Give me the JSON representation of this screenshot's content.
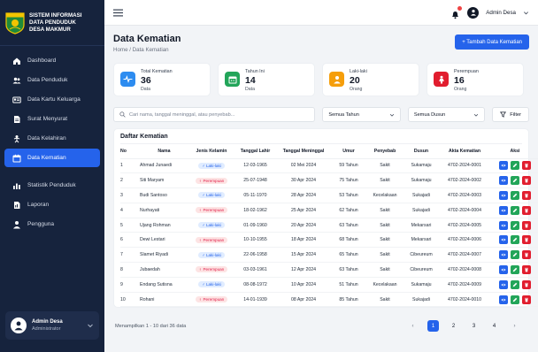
{
  "brand": {
    "line1": "SISTEM INFORMASI",
    "line2": "DATA PENDUDUK",
    "line3": "DESA MAKMUR"
  },
  "nav": [
    {
      "label": "Dashboard",
      "icon": "home-icon"
    },
    {
      "label": "Data Penduduk",
      "icon": "users-icon"
    },
    {
      "label": "Data Kartu Keluarga",
      "icon": "id-card-icon"
    },
    {
      "label": "Surat Menyurat",
      "icon": "document-icon"
    },
    {
      "label": "Data Kelahiran",
      "icon": "baby-icon"
    },
    {
      "label": "Data Kematian",
      "icon": "calendar-icon",
      "active": true
    },
    {
      "label": "Statistik Penduduk",
      "icon": "bar-chart-icon"
    },
    {
      "label": "Laporan",
      "icon": "report-icon"
    },
    {
      "label": "Pengguna",
      "icon": "user-icon"
    }
  ],
  "user": {
    "name": "Admin Desa",
    "role": "Administrator"
  },
  "topbar": {
    "user_name": "Admin Desa"
  },
  "page": {
    "title": "Data Kematian",
    "breadcrumb": "Home  /  Data Kematian",
    "add_button": "+ Tambah Data Kematian"
  },
  "stats": [
    {
      "label": "Total Kematian",
      "value": "36",
      "unit": "Data",
      "color": "#2d8cf0",
      "icon": "pulse-icon"
    },
    {
      "label": "Tahun Ini",
      "value": "14",
      "unit": "Data",
      "color": "#22a559",
      "icon": "calendar-icon"
    },
    {
      "label": "Laki-laki",
      "value": "20",
      "unit": "Orang",
      "color": "#f59e0b",
      "icon": "male-icon"
    },
    {
      "label": "Perempuan",
      "value": "16",
      "unit": "Orang",
      "color": "#e11d2e",
      "icon": "female-icon"
    }
  ],
  "filters": {
    "search_placeholder": "Cari nama, tanggal meninggal, atau penyebab...",
    "year": "Semua Tahun",
    "dusun": "Semua Dusun",
    "filter_button": "Filter"
  },
  "table": {
    "title": "Daftar Kematian",
    "headers": [
      "No",
      "Nama",
      "Jenis Kelamin",
      "Tanggal Lahir",
      "Tanggal Meninggal",
      "Umur",
      "Penyebab",
      "Dusun",
      "Akta Kematian",
      "Aksi"
    ],
    "rows": [
      {
        "no": "1",
        "nama": "Ahmad Junaedi",
        "jk": "Laki-laki",
        "g": "m",
        "lahir": "12-03-1965",
        "meninggal": "02 Mei 2024",
        "umur": "59 Tahun",
        "penyebab": "Sakit",
        "dusun": "Sukamaju",
        "akta": "4702-2024-0001"
      },
      {
        "no": "2",
        "nama": "Siti Maryam",
        "jk": "Perempuan",
        "g": "f",
        "lahir": "25-07-1948",
        "meninggal": "30 Apr 2024",
        "umur": "75 Tahun",
        "penyebab": "Sakit",
        "dusun": "Sukamaju",
        "akta": "4702-2024-0002"
      },
      {
        "no": "3",
        "nama": "Budi Santoso",
        "jk": "Laki-laki",
        "g": "m",
        "lahir": "05-11-1970",
        "meninggal": "28 Apr 2024",
        "umur": "53 Tahun",
        "penyebab": "Kecelakaan",
        "dusun": "Sukajadi",
        "akta": "4702-2024-0003"
      },
      {
        "no": "4",
        "nama": "Nurhayati",
        "jk": "Perempuan",
        "g": "f",
        "lahir": "18-02-1962",
        "meninggal": "25 Apr 2024",
        "umur": "62 Tahun",
        "penyebab": "Sakit",
        "dusun": "Sukajadi",
        "akta": "4702-2024-0004"
      },
      {
        "no": "5",
        "nama": "Ujang Rohman",
        "jk": "Laki-laki",
        "g": "m",
        "lahir": "01-09-1960",
        "meninggal": "20 Apr 2024",
        "umur": "63 Tahun",
        "penyebab": "Sakit",
        "dusun": "Mekarsari",
        "akta": "4702-2024-0005"
      },
      {
        "no": "6",
        "nama": "Dewi Lestari",
        "jk": "Perempuan",
        "g": "f",
        "lahir": "10-10-1955",
        "meninggal": "18 Apr 2024",
        "umur": "68 Tahun",
        "penyebab": "Sakit",
        "dusun": "Mekarsari",
        "akta": "4702-2024-0006"
      },
      {
        "no": "7",
        "nama": "Slamet Riyadi",
        "jk": "Laki-laki",
        "g": "m",
        "lahir": "22-06-1958",
        "meninggal": "15 Apr 2024",
        "umur": "65 Tahun",
        "penyebab": "Sakit",
        "dusun": "Cibeureum",
        "akta": "4702-2024-0007"
      },
      {
        "no": "8",
        "nama": "Jubaedah",
        "jk": "Perempuan",
        "g": "f",
        "lahir": "03-03-1961",
        "meninggal": "12 Apr 2024",
        "umur": "63 Tahun",
        "penyebab": "Sakit",
        "dusun": "Cibeureum",
        "akta": "4702-2024-0008"
      },
      {
        "no": "9",
        "nama": "Endang Sutisna",
        "jk": "Laki-laki",
        "g": "m",
        "lahir": "08-08-1972",
        "meninggal": "10 Apr 2024",
        "umur": "51 Tahun",
        "penyebab": "Kecelakaan",
        "dusun": "Sukamaju",
        "akta": "4702-2024-0009"
      },
      {
        "no": "10",
        "nama": "Rohani",
        "jk": "Perempuan",
        "g": "f",
        "lahir": "14-01-1939",
        "meninggal": "08 Apr 2024",
        "umur": "85 Tahun",
        "penyebab": "Sakit",
        "dusun": "Sukajadi",
        "akta": "4702-2024-0010"
      }
    ]
  },
  "pagination": {
    "summary": "Menampilkan 1 - 10 dari 36 data",
    "pages": [
      "1",
      "2",
      "3",
      "4"
    ],
    "current": "1",
    "prev": "‹",
    "next": "›"
  }
}
